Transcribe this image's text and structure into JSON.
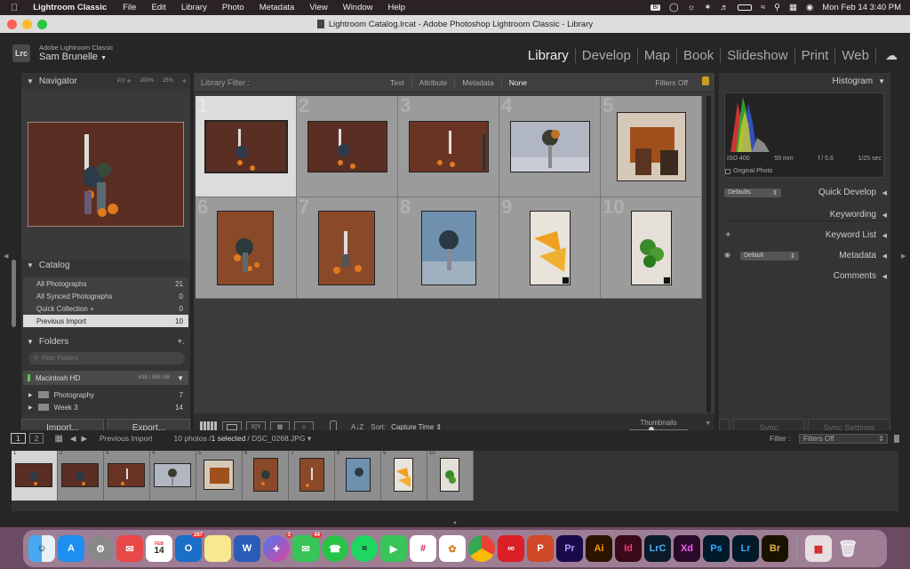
{
  "menubar": {
    "apple": "",
    "app_name": "Lightroom Classic",
    "items": [
      "File",
      "Edit",
      "Library",
      "Photo",
      "Metadata",
      "View",
      "Window",
      "Help"
    ],
    "datetime": "Mon Feb 14  3:40 PM",
    "status_icons": [
      "bd-icon",
      "creative-cloud-icon",
      "bluetooth-icon",
      "volume-icon",
      "battery-icon",
      "wifi-icon",
      "search-icon",
      "control-center-icon",
      "siri-icon"
    ]
  },
  "window": {
    "title": "Lightroom Catalog.lrcat - Adobe Photoshop Lightroom Classic - Library"
  },
  "identity": {
    "badge": "Lrc",
    "product": "Adobe Lightroom Classic",
    "user": "Sam Brunelle",
    "user_caret": "▼"
  },
  "modules": [
    "Library",
    "Develop",
    "Map",
    "Book",
    "Slideshow",
    "Print",
    "Web"
  ],
  "active_module": "Library",
  "navigator": {
    "title": "Navigator",
    "zoom_options": [
      "FIT ≑",
      "100%",
      "25%",
      "≑"
    ]
  },
  "catalog": {
    "title": "Catalog",
    "items": [
      {
        "label": "All Photographs",
        "count": "21"
      },
      {
        "label": "All Synced Photographs",
        "count": "0"
      },
      {
        "label": "Quick Collection  +",
        "count": "0"
      },
      {
        "label": "Previous Import",
        "count": "10"
      }
    ]
  },
  "folders": {
    "title": "Folders",
    "add": "+.",
    "filter_placeholder": "Filter Folders",
    "volume": {
      "name": "Macintosh HD",
      "size": "638 / 995 GB",
      "caret": "▼"
    },
    "items": [
      {
        "label": "Photography",
        "count": "7"
      },
      {
        "label": "Week 3",
        "count": "14"
      }
    ]
  },
  "left_buttons": {
    "import": "Import...",
    "export": "Export..."
  },
  "library_filter": {
    "label": "Library Filter :",
    "options": [
      "Text",
      "Attribute",
      "Metadata",
      "None"
    ],
    "active": "None",
    "filters_status": "Filters Off"
  },
  "grid": {
    "numbers": [
      "1",
      "2",
      "3",
      "4",
      "5",
      "6",
      "7",
      "8",
      "9",
      "10"
    ]
  },
  "toolbar": {
    "sort_label": "Sort:",
    "sort_value": "Capture Time",
    "thumbnails_label": "Thumbnails",
    "view_icons": [
      "grid-view-icon",
      "loupe-view-icon",
      "compare-view-icon",
      "survey-view-icon",
      "people-view-icon"
    ],
    "xy_label": "X|Y",
    "az_label": "A↓Z"
  },
  "histogram": {
    "title": "Histogram",
    "iso": "ISO 400",
    "focal": "55 mm",
    "aperture": "f / 5.6",
    "shutter": "1/25 sec",
    "original_photo": "Original Photo"
  },
  "right_panels": {
    "quick_develop": {
      "title": "Quick Develop",
      "preset": "Defaults"
    },
    "keywording": "Keywording",
    "keyword_list": {
      "title": "Keyword List",
      "add": "+"
    },
    "metadata": {
      "title": "Metadata",
      "preset": "Default"
    },
    "comments": "Comments"
  },
  "right_buttons": {
    "sync": "Sync",
    "sync_settings": "Sync Settings"
  },
  "filmstrip_bar": {
    "pages": [
      "1",
      "2"
    ],
    "source": "Previous Import",
    "count_text": "10 photos /",
    "selected_text": "1 selected",
    "file": "/ DSC_0268.JPG",
    "filter_label": "Filter :",
    "filter_value": "Filters Off"
  },
  "filmstrip": {
    "numbers": [
      "1",
      "2",
      "3",
      "4",
      "5",
      "6",
      "7",
      "8",
      "9",
      "10"
    ]
  },
  "dock": {
    "mail_badge": "287",
    "messenger_badge": "3",
    "messages_badge": "44",
    "calendar_month": "FEB",
    "calendar_day": "14",
    "apps": [
      "Pr",
      "Ai",
      "Id",
      "LrC",
      "Xd",
      "Ps",
      "Lr",
      "Br"
    ]
  },
  "colors": {
    "accent": "#dddddd",
    "panel": "#343434",
    "grid_cell": "#9b9b9b",
    "selected_cell": "#dcdcdc"
  }
}
